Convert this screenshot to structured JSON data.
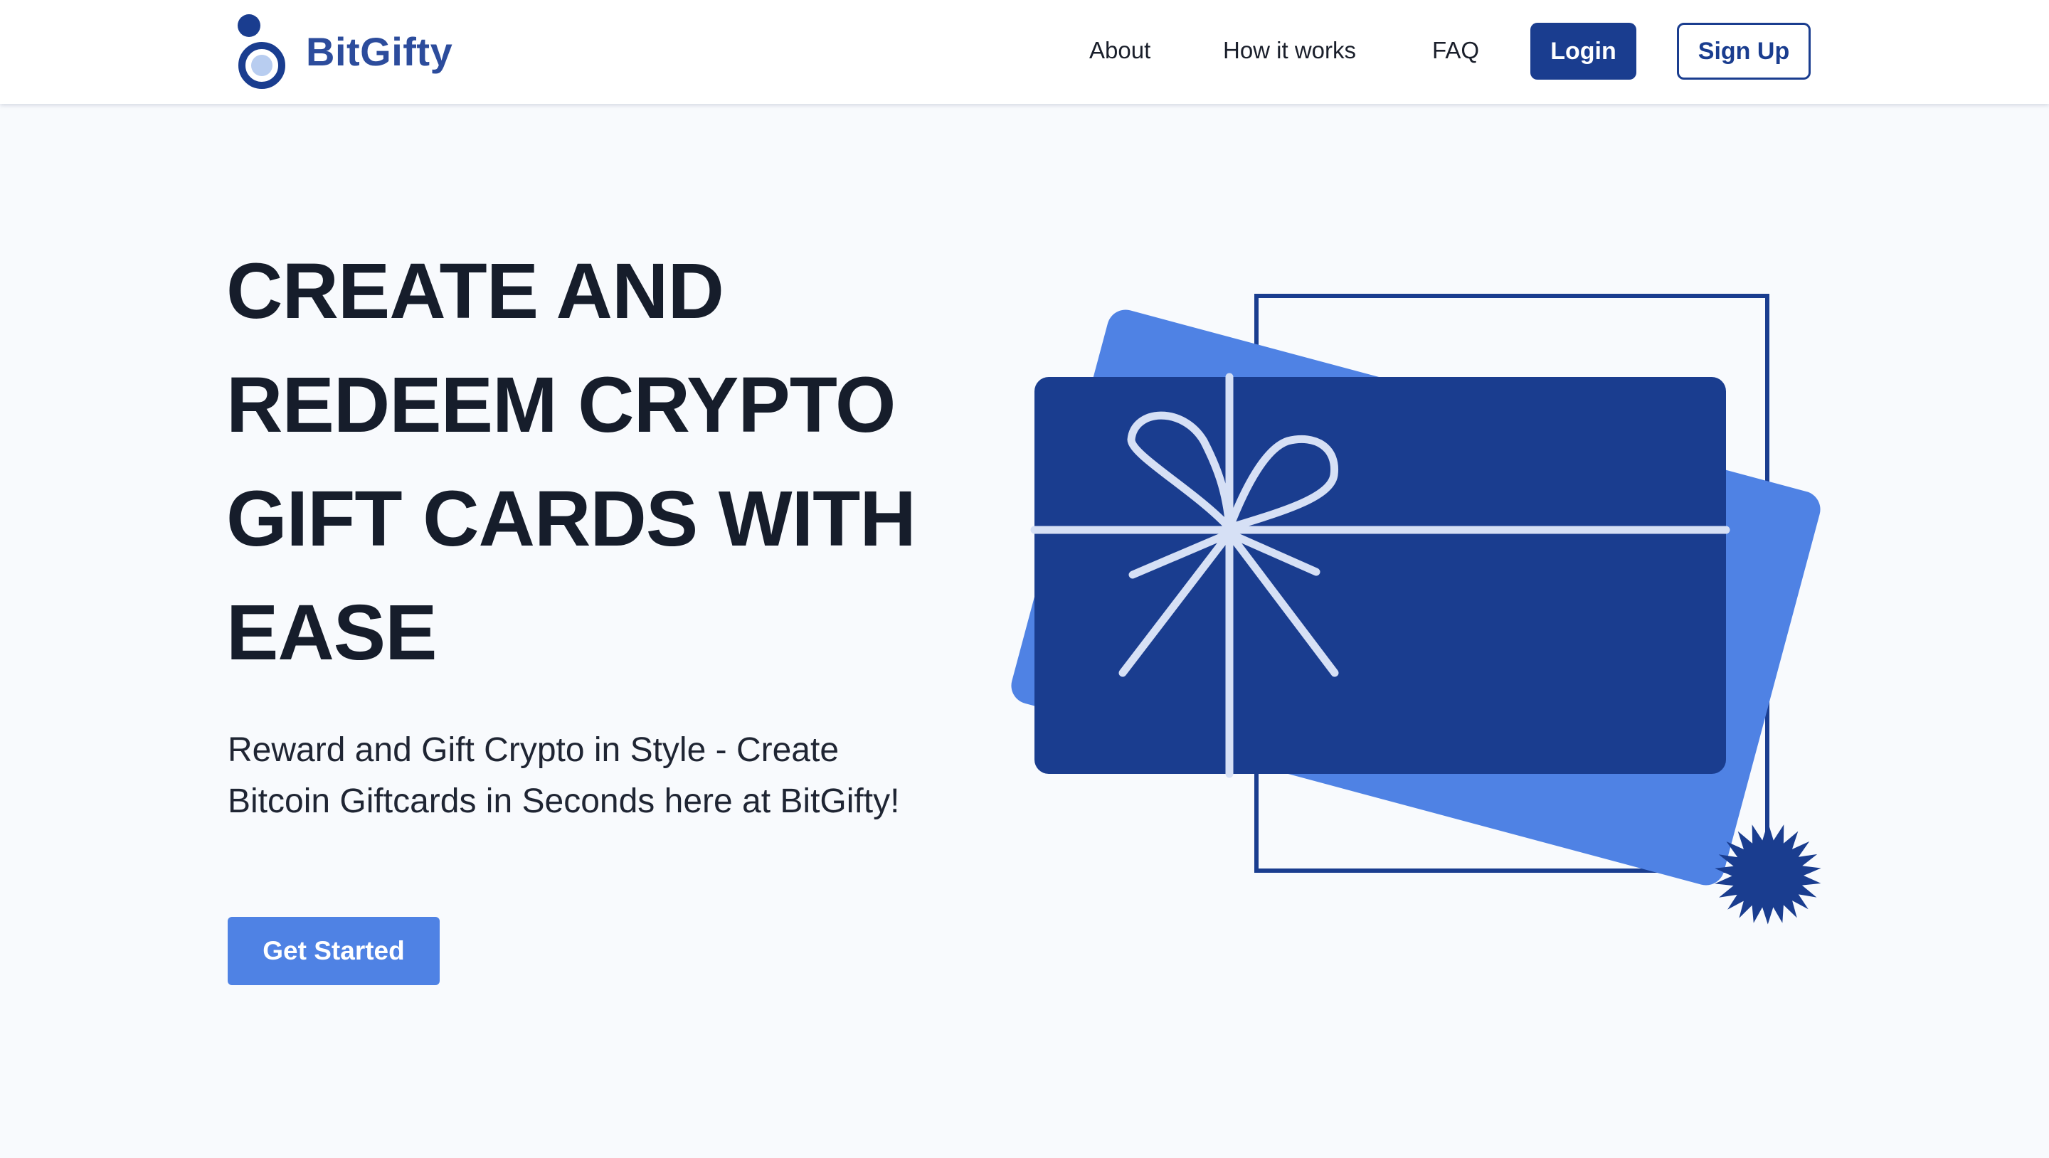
{
  "brand": {
    "name": "BitGifty"
  },
  "nav": {
    "about": "About",
    "how_it_works": "How it works",
    "faq": "FAQ",
    "login": "Login",
    "signup": "Sign Up"
  },
  "hero": {
    "headline_lines": [
      "CREATE AND",
      "REDEEM CRYPTO",
      "GIFT CARDS WITH",
      "EASE"
    ],
    "subtitle": "Reward and Gift Crypto in Style - Create Bitcoin Giftcards in Seconds here at BitGifty!",
    "cta": "Get Started"
  },
  "colors": {
    "primary": "#1a3d8f",
    "accent": "#4f82e4",
    "brand_text": "#2c4c9c",
    "ribbon": "#d6e0f5",
    "background": "#f8fafd"
  },
  "icons": {
    "logo": "bitgifty-logo-icon",
    "illustration": "gift-card-illustration"
  }
}
